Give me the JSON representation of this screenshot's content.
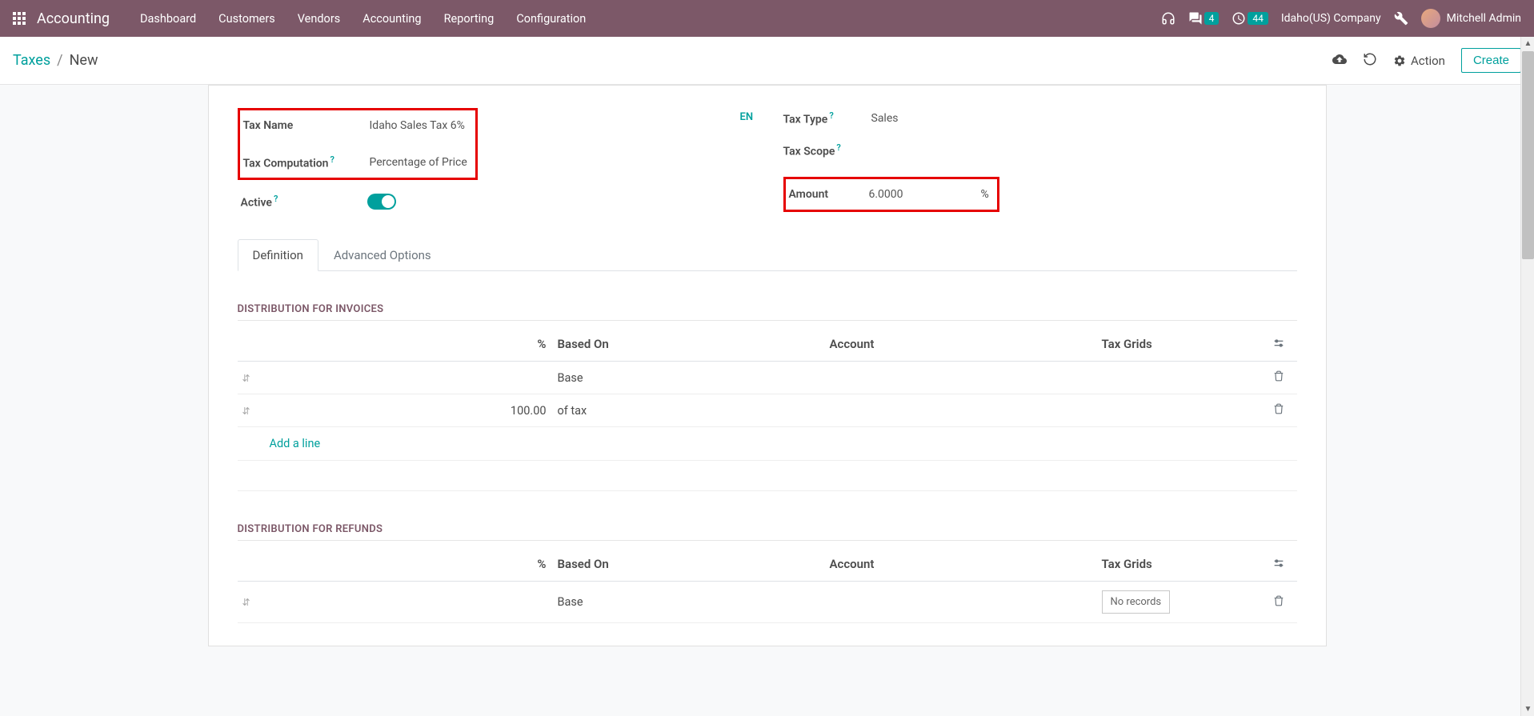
{
  "topnav": {
    "app": "Accounting",
    "items": [
      "Dashboard",
      "Customers",
      "Vendors",
      "Accounting",
      "Reporting",
      "Configuration"
    ],
    "messages_badge": "4",
    "activities_badge": "44",
    "company": "Idaho(US) Company",
    "user": "Mitchell Admin"
  },
  "control_panel": {
    "bc_root": "Taxes",
    "bc_current": "New",
    "action": "Action",
    "create": "Create"
  },
  "form": {
    "tax_name_label": "Tax Name",
    "tax_name_value": "Idaho Sales Tax 6%",
    "tax_computation_label": "Tax Computation",
    "tax_computation_value": "Percentage of Price",
    "active_label": "Active",
    "lang": "EN",
    "tax_type_label": "Tax Type",
    "tax_type_value": "Sales",
    "tax_scope_label": "Tax Scope",
    "tax_scope_value": "",
    "amount_label": "Amount",
    "amount_value": "6.0000",
    "amount_unit": "%"
  },
  "tabs": {
    "definition": "Definition",
    "advanced": "Advanced Options"
  },
  "sections": {
    "invoices_title": "DISTRIBUTION FOR INVOICES",
    "refunds_title": "DISTRIBUTION FOR REFUNDS"
  },
  "columns": {
    "pct": "%",
    "based_on": "Based On",
    "account": "Account",
    "tax_grids": "Tax Grids"
  },
  "invoices_rows": [
    {
      "pct": "",
      "based_on": "Base",
      "account": "",
      "tax_grids": ""
    },
    {
      "pct": "100.00",
      "based_on": "of tax",
      "account": "",
      "tax_grids": ""
    }
  ],
  "refunds_rows": [
    {
      "pct": "",
      "based_on": "Base",
      "account": "",
      "tax_grids": ""
    }
  ],
  "add_line": "Add a line",
  "no_records": "No records"
}
